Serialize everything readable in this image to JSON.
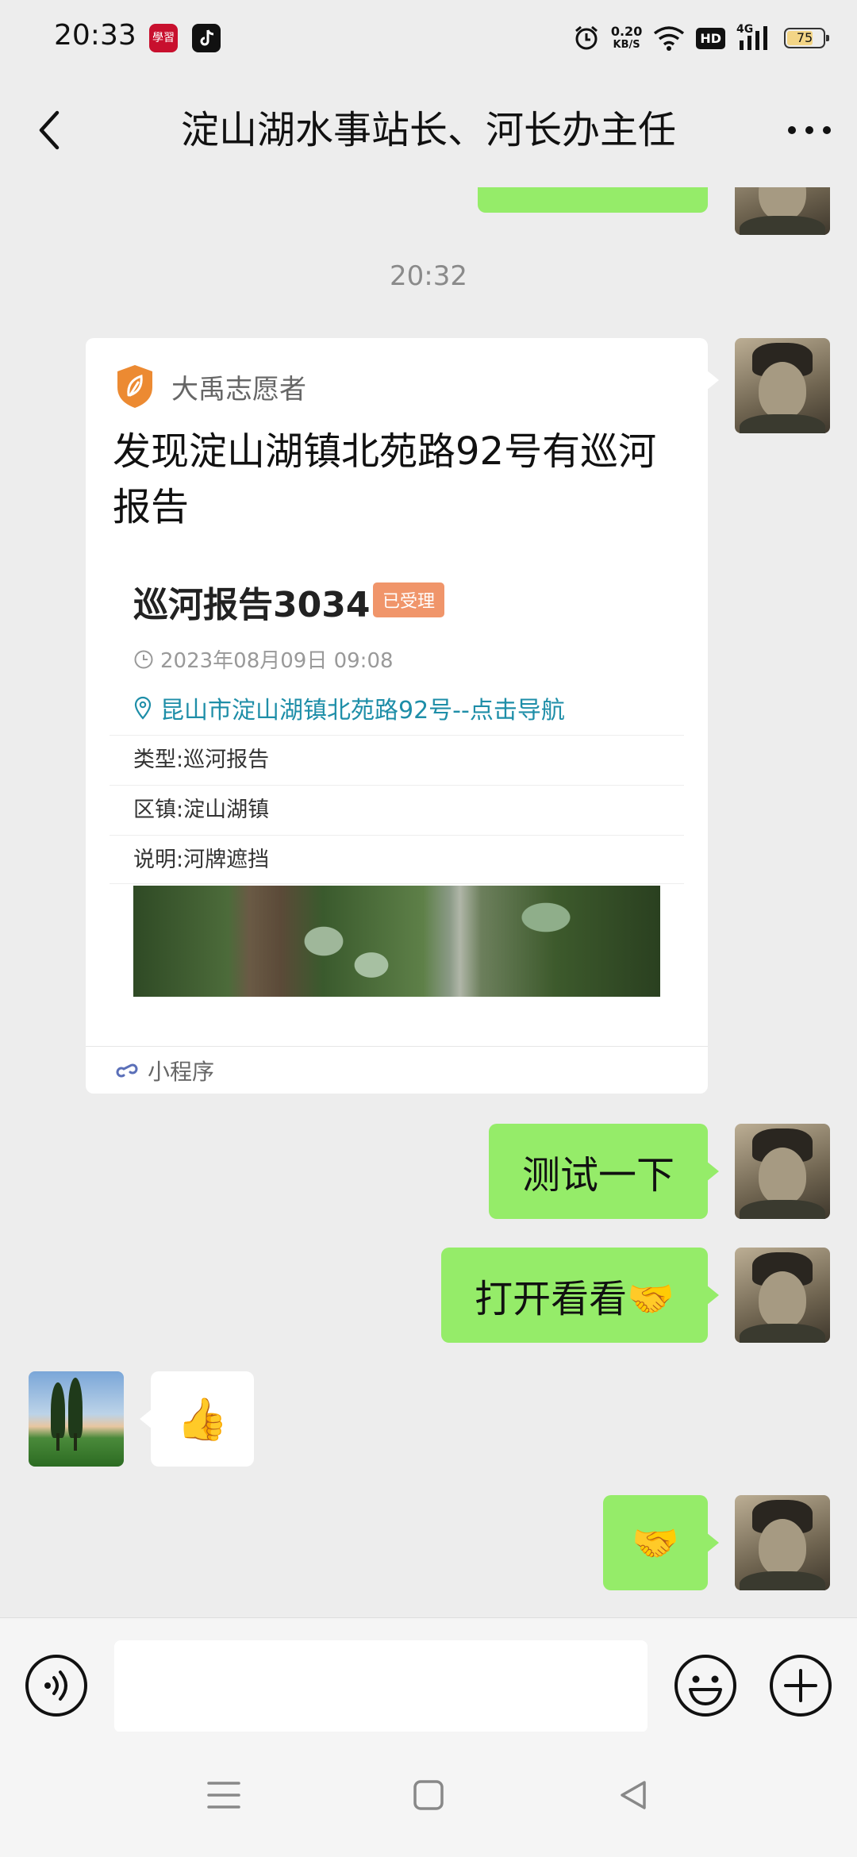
{
  "status_bar": {
    "time": "20:33",
    "app_icon_1_text": "學習",
    "net_speed_value": "0.20",
    "net_speed_unit": "KB/S",
    "hd_label": "HD",
    "signal_label": "4G",
    "battery_level": "75",
    "battery_fill_fraction": 0.75
  },
  "header": {
    "title": "淀山湖水事站长、河长办主任"
  },
  "chat": {
    "timestamp": "20:32",
    "mini_program_card": {
      "brand_name": "大禹志愿者",
      "title": "发现淀山湖镇北苑路92号有巡河报告",
      "report_title": "巡河报告3034",
      "status_badge": "已受理",
      "datetime": "2023年08月09日 09:08",
      "address": "昆山市淀山湖镇北苑路92号--点击导航",
      "fields": [
        {
          "label": "类型:",
          "value": "巡河报告"
        },
        {
          "label": "区镇:",
          "value": "淀山湖镇"
        },
        {
          "label": "说明:",
          "value": "河牌遮挡"
        }
      ],
      "footer_label": "小程序"
    },
    "messages": [
      {
        "text": "测试一下"
      },
      {
        "text": "打开看看🤝"
      },
      {
        "text": "👍"
      },
      {
        "text": "🤝"
      }
    ]
  },
  "colors": {
    "bubble_green": "#95ec69",
    "background": "#ededed",
    "badge": "#f0956a",
    "link": "#1e8ea8",
    "brand_orange": "#ec8a32"
  },
  "icons": [
    "back-arrow-icon",
    "more-dots-icon",
    "shield-leaf-icon",
    "clock-icon",
    "location-pin-icon",
    "mini-program-link-icon",
    "voice-icon",
    "emoji-icon",
    "plus-icon",
    "menu-icon",
    "home-square-icon",
    "back-triangle-icon"
  ]
}
